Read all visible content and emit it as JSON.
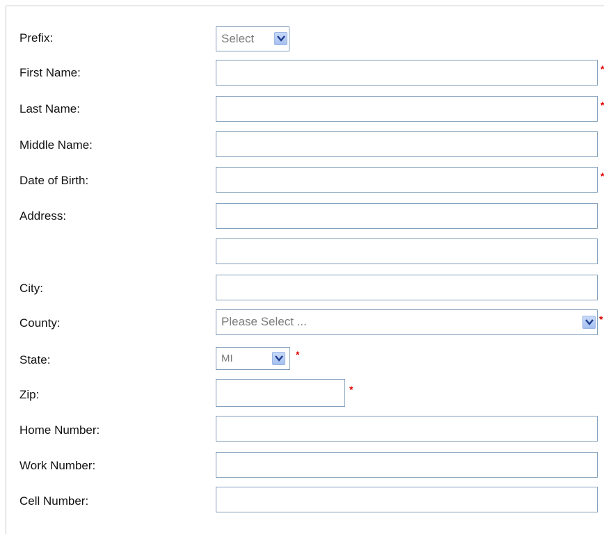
{
  "form": {
    "prefix": {
      "label": "Prefix:",
      "selected": "Select"
    },
    "first_name": {
      "label": "First Name:",
      "value": "",
      "required_mark": "*"
    },
    "last_name": {
      "label": "Last Name:",
      "value": "",
      "required_mark": "*"
    },
    "middle_name": {
      "label": "Middle Name:",
      "value": ""
    },
    "date_of_birth": {
      "label": "Date of Birth:",
      "value": "",
      "required_mark": "*"
    },
    "address": {
      "label": "Address:",
      "line1": "",
      "line2": ""
    },
    "city": {
      "label": "City:",
      "value": ""
    },
    "county": {
      "label": "County:",
      "selected": "Please Select ...",
      "required_mark": "*"
    },
    "state": {
      "label": "State:",
      "selected": "MI",
      "required_mark": "*"
    },
    "zip": {
      "label": "Zip:",
      "value": "",
      "required_mark": "*"
    },
    "home_number": {
      "label": "Home Number:",
      "value": ""
    },
    "work_number": {
      "label": "Work Number:",
      "value": ""
    },
    "cell_number": {
      "label": "Cell Number:",
      "value": ""
    }
  },
  "icons": {
    "dropdown": "chevron-down-icon"
  },
  "colors": {
    "input_border": "#7f9db9",
    "required": "#e00000",
    "dropdown_button": "#b7cdf4"
  }
}
